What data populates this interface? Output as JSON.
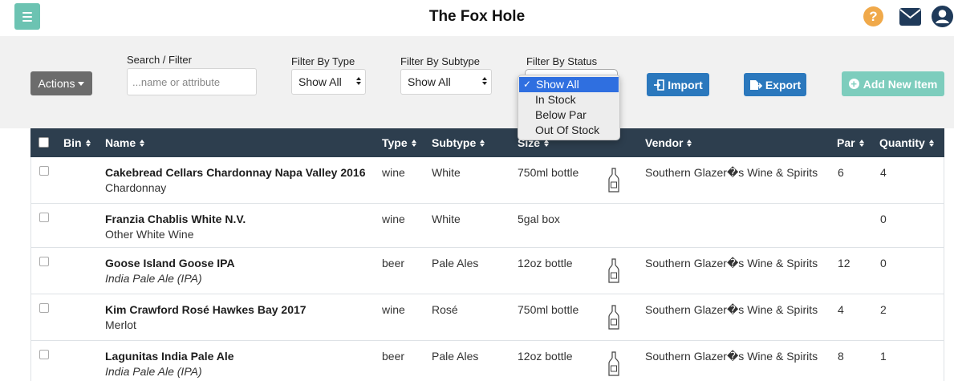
{
  "app": {
    "title": "The Fox Hole",
    "menu_icon": "hamburger-menu-icon",
    "help_icon": "help-circle-icon",
    "mail_icon": "envelope-icon",
    "user_icon": "user-circle-icon",
    "help_glyph": "?"
  },
  "toolbar": {
    "actions_label": "Actions",
    "search_label": "Search / Filter",
    "search_placeholder": "...name or attribute",
    "type_label": "Filter By Type",
    "type_value": "Show All",
    "subtype_label": "Filter By Subtype",
    "subtype_value": "Show All",
    "status_label": "Filter By Status",
    "status_options": [
      "Show All",
      "In Stock",
      "Below Par",
      "Out Of Stock"
    ],
    "status_selected": "Show All",
    "import_label": "Import",
    "export_label": "Export",
    "add_label": "Add New Item"
  },
  "table": {
    "columns": {
      "bin": "Bin",
      "name": "Name",
      "type": "Type",
      "subtype": "Subtype",
      "size": "Size",
      "vendor": "Vendor",
      "par": "Par",
      "quantity": "Quantity"
    },
    "rows": [
      {
        "name": "Cakebread Cellars Chardonnay Napa Valley 2016",
        "variety": "Chardonnay",
        "variety_italic": false,
        "type": "wine",
        "subtype": "White",
        "size": "750ml bottle",
        "bottle_icon": true,
        "vendor": "Southern Glazer�s Wine & Spirits",
        "par": "6",
        "quantity": "4"
      },
      {
        "name": "Franzia Chablis White N.V.",
        "variety": "Other White Wine",
        "variety_italic": false,
        "type": "wine",
        "subtype": "White",
        "size": "5gal box",
        "bottle_icon": false,
        "vendor": "",
        "par": "",
        "quantity": "0"
      },
      {
        "name": "Goose Island Goose IPA",
        "variety": "India Pale Ale (IPA)",
        "variety_italic": true,
        "type": "beer",
        "subtype": "Pale Ales",
        "size": "12oz bottle",
        "bottle_icon": true,
        "vendor": "Southern Glazer�s Wine & Spirits",
        "par": "12",
        "quantity": "0"
      },
      {
        "name": "Kim Crawford Rosé Hawkes Bay 2017",
        "variety": "Merlot",
        "variety_italic": false,
        "type": "wine",
        "subtype": "Rosé",
        "size": "750ml bottle",
        "bottle_icon": true,
        "vendor": "Southern Glazer�s Wine & Spirits",
        "par": "4",
        "quantity": "2"
      },
      {
        "name": "Lagunitas India Pale Ale",
        "variety": "India Pale Ale (IPA)",
        "variety_italic": true,
        "type": "beer",
        "subtype": "Pale Ales",
        "size": "12oz bottle",
        "bottle_icon": true,
        "vendor": "Southern Glazer�s Wine & Spirits",
        "par": "8",
        "quantity": "1"
      }
    ]
  },
  "colors": {
    "header_bg": "#2d3e4e",
    "accent_teal": "#6cc3b2",
    "button_blue": "#2b78bd",
    "help_orange": "#f0a94a",
    "selection_blue": "#2f6fe0"
  }
}
